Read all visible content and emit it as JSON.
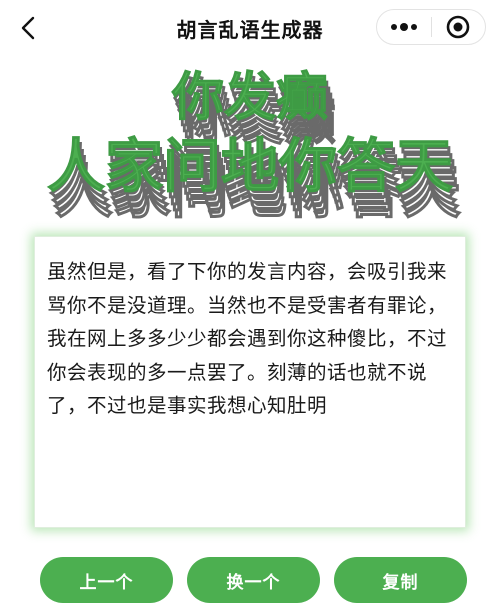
{
  "nav": {
    "title": "胡言乱语生成器",
    "back_icon": "chevron-left-icon",
    "more_icon": "more-dots-icon",
    "close_icon": "target-close-icon"
  },
  "heading": {
    "line1": "你发癫",
    "line2": "人家问地你答天"
  },
  "content": {
    "text": "虽然但是，看了下你的发言内容，会吸引我来骂你不是没道理。当然也不是受害者有罪论，我在网上多多少少都会遇到你这种傻比，不过你会表现的多一点罢了。刻薄的话也就不说了，不过也是事实我想心知肚明"
  },
  "buttons": {
    "prev": "上一个",
    "next": "换一个",
    "copy": "复制"
  },
  "colors": {
    "accent": "#4caf50",
    "heading_outline": "#6a6a6a"
  }
}
